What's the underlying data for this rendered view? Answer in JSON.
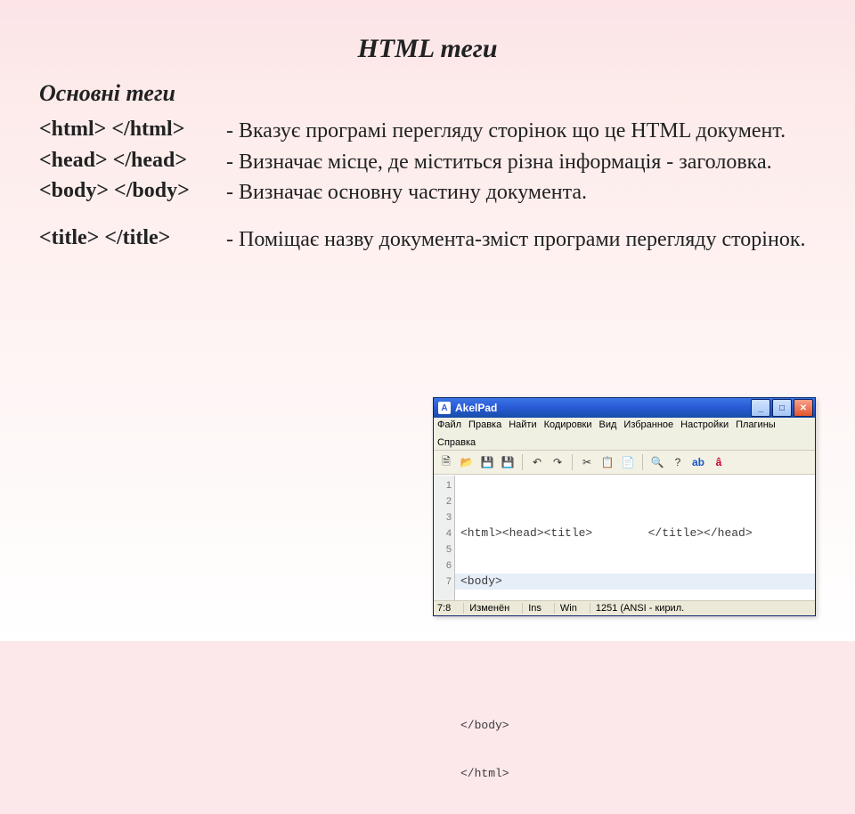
{
  "slide": {
    "title": "HTML теги",
    "subtitle": "Основні теги",
    "rows": [
      {
        "tags": "<html>  </html>",
        "desc": "- Вказує програмі перегляду сторінок що це HTML документ."
      },
      {
        "tags": "<head>  </head>",
        "desc": "- Визначає місце, де міститься різна інформація - заголовка."
      },
      {
        "tags": "<body>  </body>",
        "desc": "- Визначає основну частину документа."
      },
      {
        "tags": "<title>  </title>",
        "desc": "- Поміщає назву документа-зміст програми перегляду сторінок."
      }
    ]
  },
  "editor": {
    "appTitle": "AkelPad",
    "menu": [
      "Файл",
      "Правка",
      "Найти",
      "Кодировки",
      "Вид",
      "Избранное",
      "Настройки",
      "Плагины",
      "Справка"
    ],
    "toolbar_icons": [
      "new-file-icon",
      "open-icon",
      "save-icon",
      "save-all-icon",
      "sep",
      "undo-icon",
      "redo-icon",
      "sep",
      "cut-icon",
      "copy-icon",
      "paste-icon",
      "sep",
      "find-icon",
      "help-icon",
      "font-icon",
      "sort-icon"
    ],
    "gutter": [
      "1",
      "2",
      "3",
      "4",
      "5",
      "6",
      "7"
    ],
    "lines": [
      "<html><head><title>        </title></head>",
      "<body>",
      "",
      "",
      "",
      "</body>",
      "</html>"
    ],
    "status": {
      "pos": "7:8",
      "state": "Изменён",
      "ins": "Ins",
      "platform": "Win",
      "enc": "1251 (ANSI - кирил."
    }
  }
}
